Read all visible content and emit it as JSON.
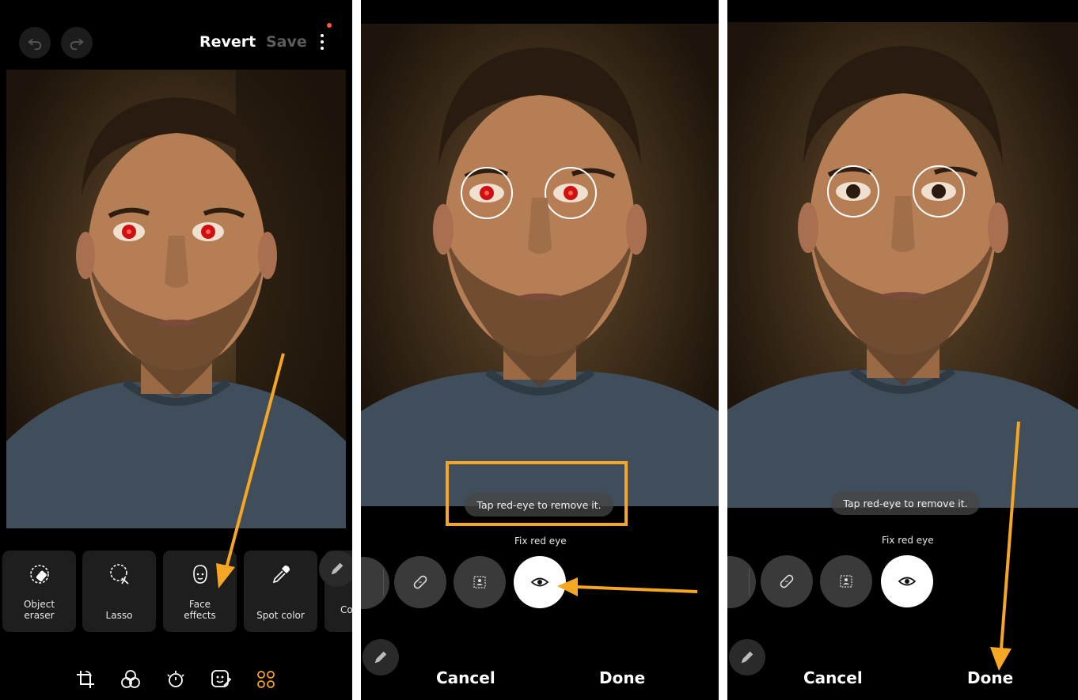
{
  "panel1": {
    "top_bar": {
      "revert_label": "Revert",
      "save_label": "Save"
    },
    "tools": [
      {
        "label": "Object\neraser",
        "icon": "object-eraser-icon"
      },
      {
        "label": "Lasso",
        "icon": "lasso-icon"
      },
      {
        "label": "Face\neffects",
        "icon": "face-icon"
      },
      {
        "label": "Spot color",
        "icon": "eyedropper-icon"
      },
      {
        "label": "Co",
        "icon": "pen-icon"
      }
    ],
    "bottom_nav": [
      "crop-rotate-icon",
      "filters-icon",
      "brightness-icon",
      "decorations-icon",
      "more-tools-icon"
    ]
  },
  "panel2": {
    "hint": "Tap red-eye to remove it.",
    "mode_label": "Fix red eye",
    "cancel_label": "Cancel",
    "done_label": "Done"
  },
  "panel3": {
    "hint": "Tap red-eye to remove it.",
    "mode_label": "Fix red eye",
    "cancel_label": "Cancel",
    "done_label": "Done"
  },
  "colors": {
    "accent": "#f5a623",
    "red_eye": "#d01010",
    "save_disabled": "#5c5c5c",
    "notification": "#ff5a3c"
  }
}
